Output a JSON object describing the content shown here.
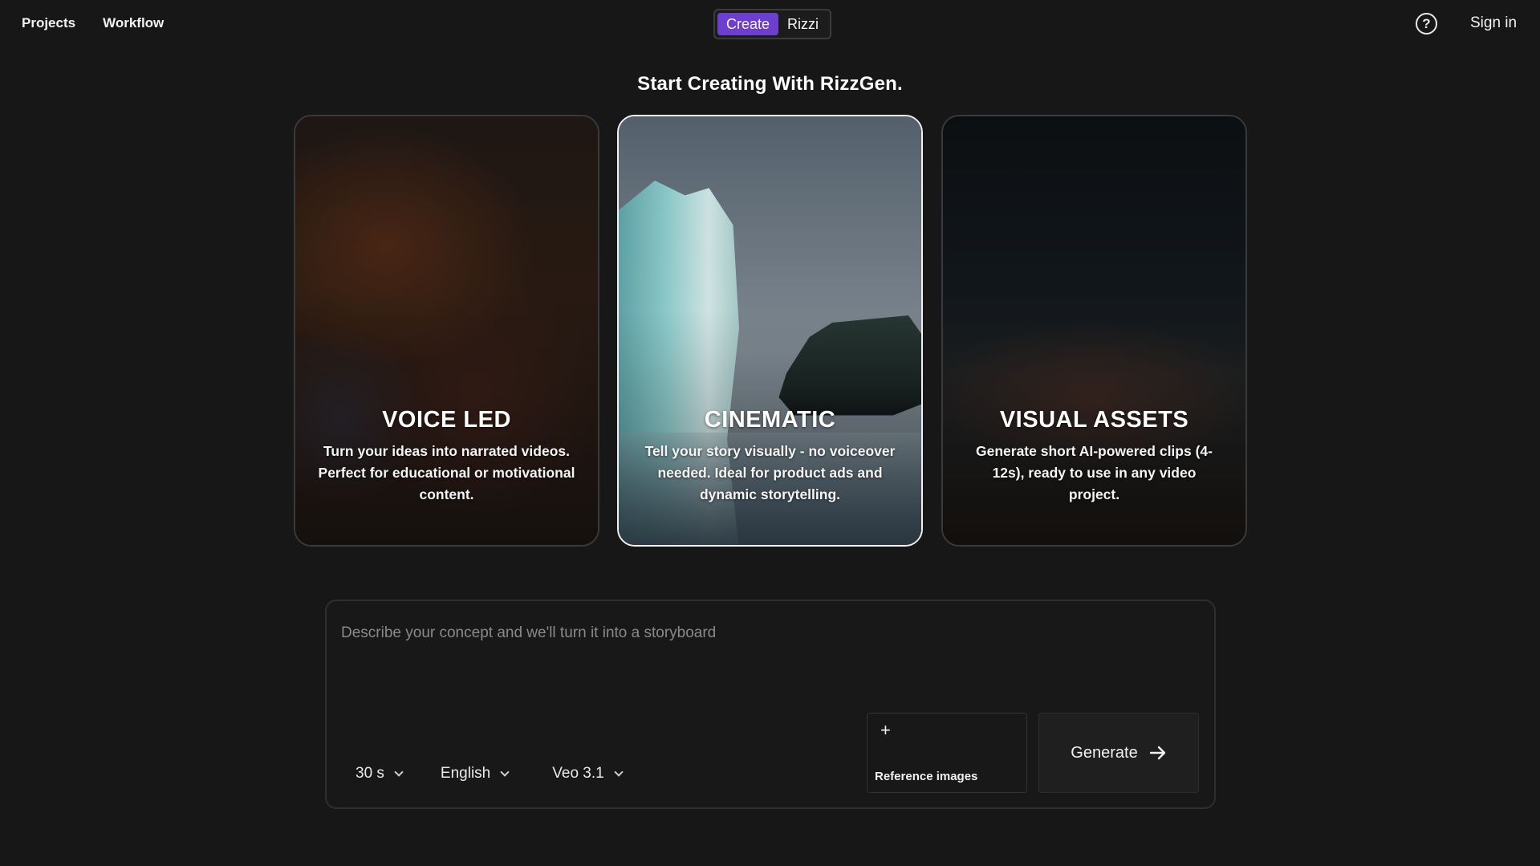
{
  "nav": {
    "projects": "Projects",
    "workflow": "Workflow",
    "sign_in": "Sign in",
    "help_icon": "?"
  },
  "mode_toggle": {
    "create": "Create",
    "rizzi": "Rizzi",
    "active": "Create",
    "accent_color": "#6d3fcf"
  },
  "heading": "Start Creating With RizzGen.",
  "cards": [
    {
      "title": "VOICE LED",
      "description": "Turn your ideas into narrated videos. Perfect for educational or motivational content.",
      "selected": false
    },
    {
      "title": "CINEMATIC",
      "description": "Tell your story visually - no voiceover needed. Ideal for product ads and dynamic storytelling.",
      "selected": true
    },
    {
      "title": "VISUAL ASSETS",
      "description": "Generate short AI-powered clips (4-12s), ready to use in any video project.",
      "selected": false
    }
  ],
  "prompt": {
    "placeholder": "Describe your concept and we'll turn it into a storyboard",
    "value": ""
  },
  "options": {
    "duration": "30 s",
    "language": "English",
    "model": "Veo 3.1"
  },
  "reference": {
    "plus": "+",
    "label": "Reference images"
  },
  "generate": {
    "label": "Generate",
    "icon": "arrow-right-icon"
  }
}
